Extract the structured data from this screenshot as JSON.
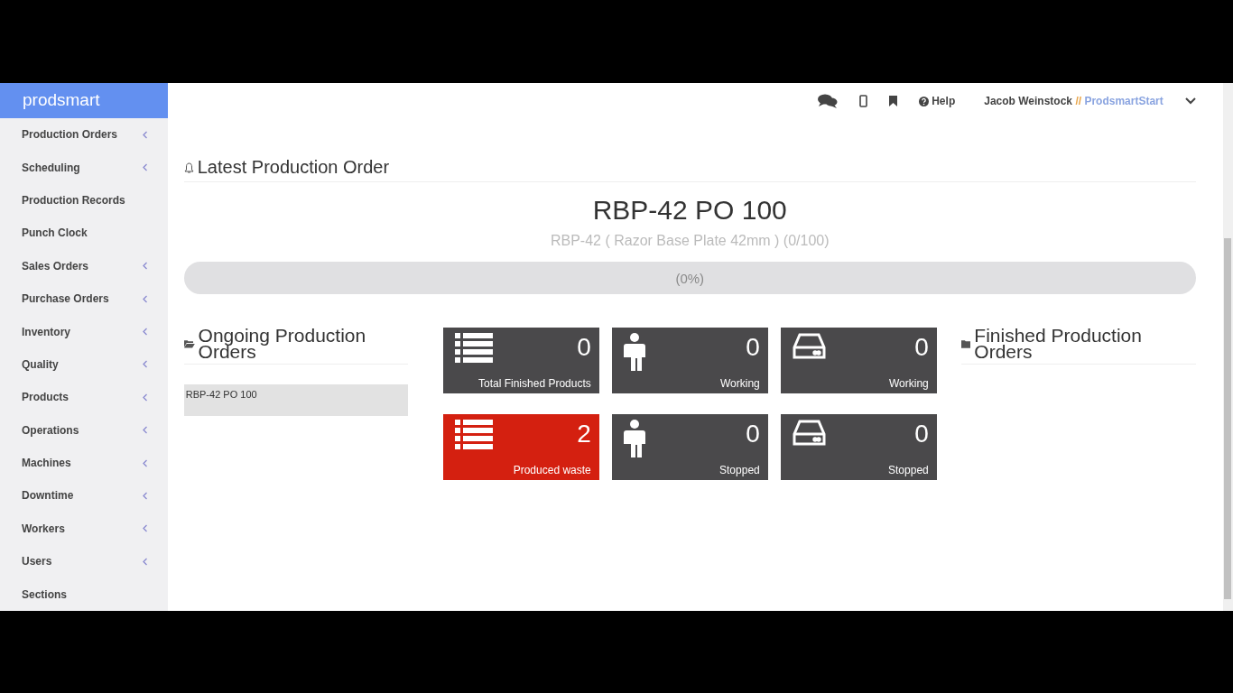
{
  "brand": "prodsmart",
  "sidebar": {
    "items": [
      {
        "label": "Production Orders",
        "has_submenu": true
      },
      {
        "label": "Scheduling",
        "has_submenu": true
      },
      {
        "label": "Production Records",
        "has_submenu": false
      },
      {
        "label": "Punch Clock",
        "has_submenu": false
      },
      {
        "label": "Sales Orders",
        "has_submenu": true
      },
      {
        "label": "Purchase Orders",
        "has_submenu": true
      },
      {
        "label": "Inventory",
        "has_submenu": true
      },
      {
        "label": "Quality",
        "has_submenu": true
      },
      {
        "label": "Products",
        "has_submenu": true
      },
      {
        "label": "Operations",
        "has_submenu": true
      },
      {
        "label": "Machines",
        "has_submenu": true
      },
      {
        "label": "Downtime",
        "has_submenu": true
      },
      {
        "label": "Workers",
        "has_submenu": true
      },
      {
        "label": "Users",
        "has_submenu": true
      },
      {
        "label": "Sections",
        "has_submenu": false
      }
    ]
  },
  "topbar": {
    "help": "Help",
    "user": "Jacob Weinstock",
    "separator": "//",
    "company": "ProdsmartStart"
  },
  "latest": {
    "heading": "Latest Production Order",
    "order": "RBP-42 PO 100",
    "detail": "RBP-42 ( Razor Base Plate 42mm ) (0/100)",
    "level": 0,
    "percent": "(0%)"
  },
  "ongoing": {
    "heading": "Ongoing Production Orders",
    "items": [
      "RBP-42 PO 100"
    ]
  },
  "tiles": [
    {
      "kind": "list",
      "value": "0",
      "label": "Total Finished Products",
      "color": "#4a494b"
    },
    {
      "kind": "person",
      "value": "0",
      "label": "Working",
      "color": "#4a494b"
    },
    {
      "kind": "drive",
      "value": "0",
      "label": "Working",
      "color": "#4a494b"
    },
    {
      "kind": "list",
      "value": "2",
      "label": "Produced waste",
      "color": "#d42010"
    },
    {
      "kind": "person",
      "value": "0",
      "label": "Stopped",
      "color": "#4a494b"
    },
    {
      "kind": "drive",
      "value": "0",
      "label": "Stopped",
      "color": "#4a494b"
    }
  ],
  "finished": {
    "heading": "Finished Production Orders"
  }
}
